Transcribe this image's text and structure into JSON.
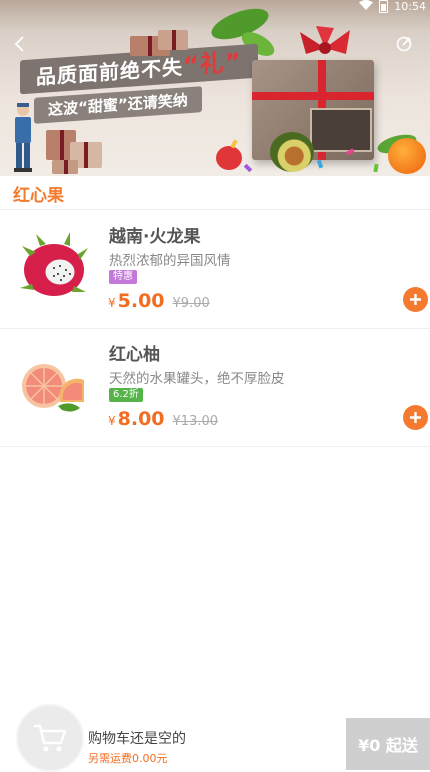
{
  "status_bar": {
    "time": "10:54"
  },
  "banner": {
    "headline": "品质面前绝不失",
    "headline_accent": "“礼”",
    "subline": "这波“甜蜜”还请笑纳"
  },
  "category": {
    "title": "红心果"
  },
  "products": [
    {
      "name": "越南·火龙果",
      "desc": "热烈浓郁的异国风情",
      "tag": "特惠",
      "tag_color": "#c478d8",
      "currency": "¥",
      "price": "5.00",
      "original_price": "¥9.00"
    },
    {
      "name": "红心柚",
      "desc": "天然的水果罐头，绝不厚脸皮",
      "tag": "6.2折",
      "tag_color": "#55b34a",
      "currency": "¥",
      "price": "8.00",
      "original_price": "¥13.00"
    }
  ],
  "cart": {
    "empty_text": "购物车还是空的",
    "fee_text": "另需运费0.00元",
    "checkout_label": "¥0 起送"
  },
  "colors": {
    "accent": "#f27a2d",
    "price": "#f26d22",
    "add_button": "#f57a2f",
    "checkout_disabled": "#cfcfcf"
  }
}
